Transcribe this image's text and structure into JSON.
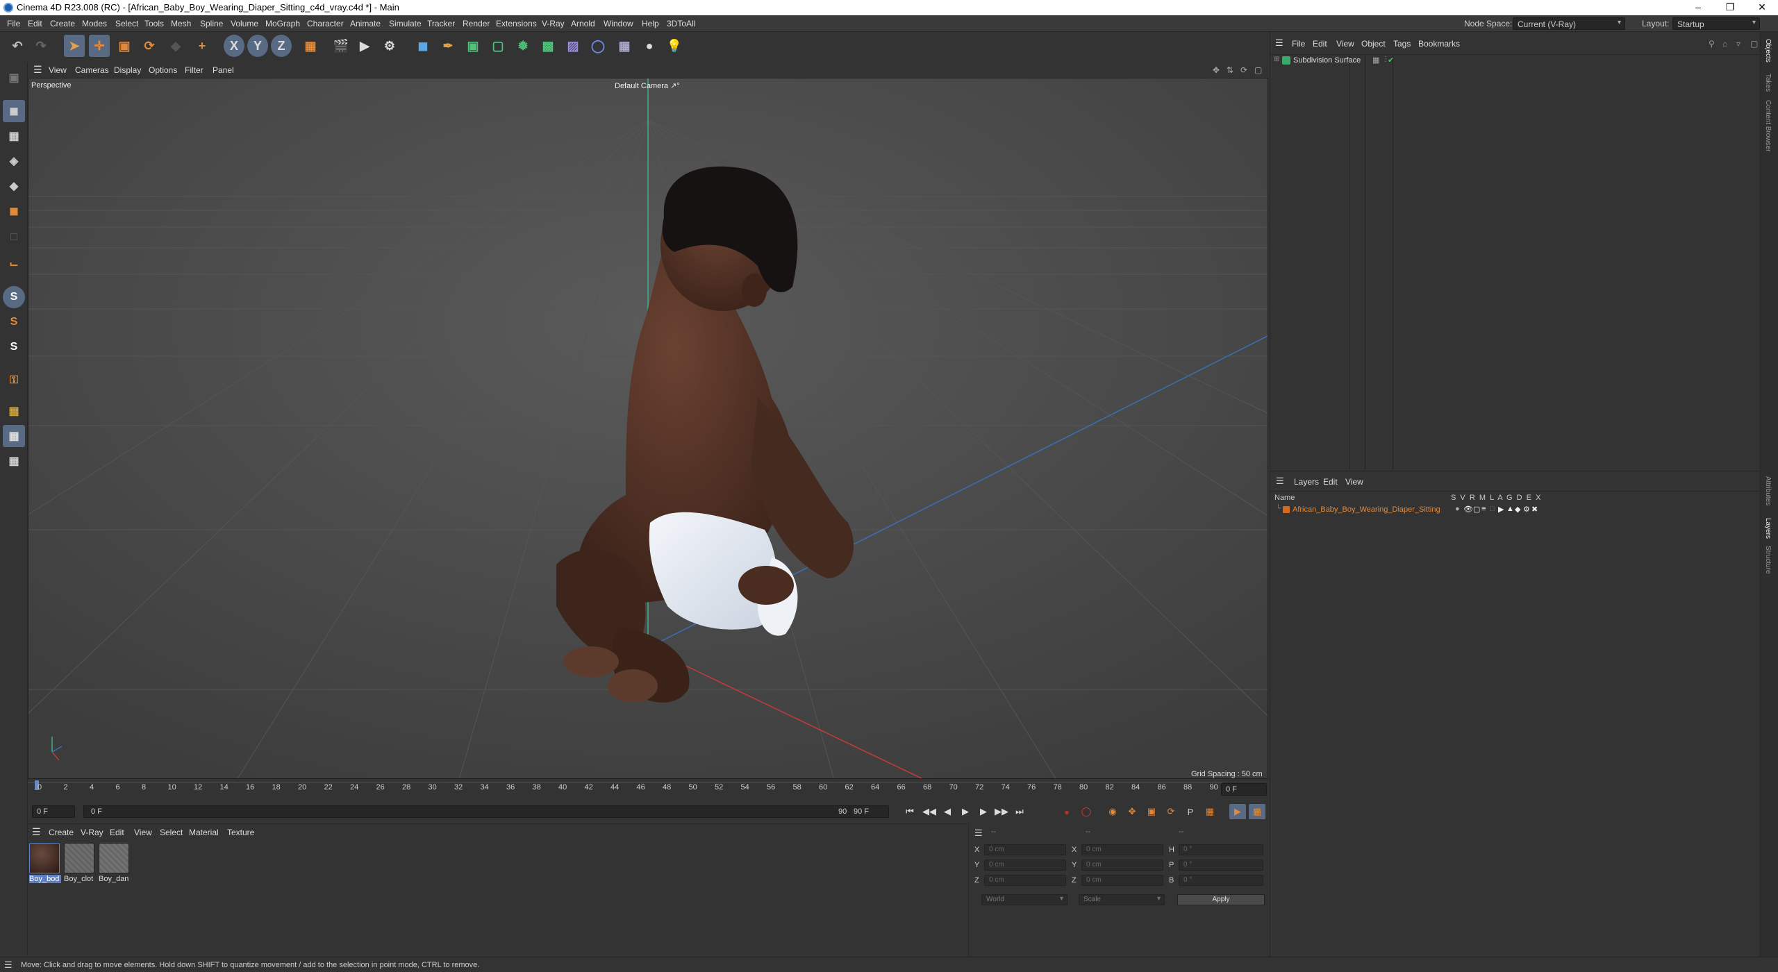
{
  "window": {
    "title": "Cinema 4D R23.008 (RC) - [African_Baby_Boy_Wearing_Diaper_Sitting_c4d_vray.c4d *] - Main"
  },
  "menu": [
    "File",
    "Edit",
    "Create",
    "Modes",
    "Select",
    "Tools",
    "Mesh",
    "Spline",
    "Volume",
    "MoGraph",
    "Character",
    "Animate",
    "Simulate",
    "Tracker",
    "Render",
    "Extensions",
    "V-Ray",
    "Arnold",
    "Window",
    "Help",
    "3DToAll"
  ],
  "node_space": {
    "label": "Node Space:",
    "value": "Current (V-Ray)"
  },
  "layout": {
    "label": "Layout:",
    "value": "Startup"
  },
  "toolbar": {
    "icons": [
      "undo-icon",
      "redo-icon",
      "live-selection-icon",
      "move-icon",
      "scale-icon",
      "rotate-icon",
      "recent-tool-icon",
      "add-object-icon",
      "x-axis-icon",
      "y-axis-icon",
      "z-axis-icon",
      "coordinate-system-icon",
      "render-region-icon",
      "render-view-icon",
      "render-settings-icon",
      "cube-icon",
      "pen-icon",
      "subdivision-icon",
      "extrude-icon",
      "cloner-icon",
      "deformer-icon",
      "environment-icon",
      "camera-icon",
      "floor-icon",
      "light-icon"
    ]
  },
  "viewport": {
    "menu": [
      "View",
      "Cameras",
      "Display",
      "Options",
      "Filter",
      "Panel"
    ],
    "projection": "Perspective",
    "camera": "Default Camera",
    "grid_spacing": "Grid Spacing : 50 cm"
  },
  "timeline": {
    "ticks": [
      "0",
      "2",
      "4",
      "6",
      "8",
      "10",
      "12",
      "14",
      "16",
      "18",
      "20",
      "22",
      "24",
      "26",
      "28",
      "30",
      "32",
      "34",
      "36",
      "38",
      "40",
      "42",
      "44",
      "46",
      "48",
      "50",
      "52",
      "54",
      "56",
      "58",
      "60",
      "62",
      "64",
      "66",
      "68",
      "70",
      "72",
      "74",
      "76",
      "78",
      "80",
      "82",
      "84",
      "86",
      "88",
      "90"
    ],
    "current_frame": "0 F"
  },
  "transport": {
    "start_field": "0 F",
    "preview_start": "0 F",
    "preview_end": "90 F",
    "end_field": "90 F"
  },
  "material_manager": {
    "menu": [
      "Create",
      "V-Ray",
      "Edit",
      "View",
      "Select",
      "Material",
      "Texture"
    ],
    "materials": [
      {
        "label": "Boy_bod",
        "color": "#3a2a24"
      },
      {
        "label": "Boy_clot",
        "color": "#6a6a6a"
      },
      {
        "label": "Boy_dan",
        "color": "#6e6e6e"
      }
    ]
  },
  "coordinates": {
    "headers": [
      "--",
      "--",
      "--"
    ],
    "rows": [
      {
        "a_label": "X",
        "a_val": "0 cm",
        "b_label": "X",
        "b_val": "0 cm",
        "c_label": "H",
        "c_val": "0 °"
      },
      {
        "a_label": "Y",
        "a_val": "0 cm",
        "b_label": "Y",
        "b_val": "0 cm",
        "c_label": "P",
        "c_val": "0 °"
      },
      {
        "a_label": "Z",
        "a_val": "0 cm",
        "b_label": "Z",
        "b_val": "0 cm",
        "c_label": "B",
        "c_val": "0 °"
      }
    ],
    "space": "World",
    "mode": "Scale",
    "apply": "Apply"
  },
  "object_manager": {
    "menu": [
      "File",
      "Edit",
      "View",
      "Object",
      "Tags",
      "Bookmarks"
    ],
    "objects": [
      {
        "name": "Subdivision Surface"
      }
    ]
  },
  "layer_manager": {
    "menu": [
      "Layers",
      "Edit",
      "View"
    ],
    "name_header": "Name",
    "column_flags": [
      "S",
      "V",
      "R",
      "M",
      "L",
      "A",
      "G",
      "D",
      "E",
      "X"
    ],
    "layers": [
      {
        "name": "African_Baby_Boy_Wearing_Diaper_Sitting",
        "color": "#d2691e"
      }
    ]
  },
  "right_tabs": [
    "Objects",
    "Takes",
    "Content Browser",
    "Attributes",
    "Layers",
    "Structure"
  ],
  "status": "Move: Click and drag to move elements. Hold down SHIFT to quantize movement / add to the selection in point mode, CTRL to remove.",
  "colors": {
    "accent": "#596a84",
    "selected_orange": "#e38a3a",
    "skin": "#4a2e22"
  }
}
